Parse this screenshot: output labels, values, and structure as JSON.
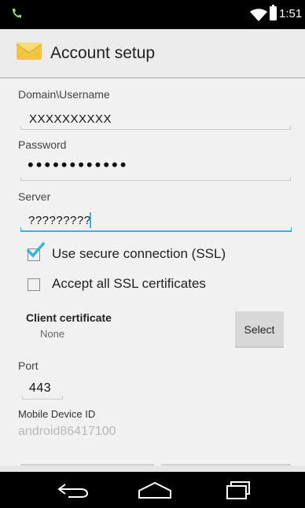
{
  "status_bar": {
    "time": "1:51"
  },
  "action_bar": {
    "title": "Account setup"
  },
  "form": {
    "domain_username": {
      "label": "Domain\\Username",
      "value": "XXXXXXXXXX"
    },
    "password": {
      "label": "Password",
      "masked_value": "••••••••••••"
    },
    "server": {
      "label": "Server",
      "value": "?????????"
    },
    "use_ssl": {
      "label": "Use secure connection (SSL)",
      "checked": true
    },
    "accept_all_ssl": {
      "label": "Accept all SSL certificates",
      "checked": false
    },
    "client_certificate": {
      "label": "Client certificate",
      "value": "None",
      "button_label": "Select"
    },
    "port": {
      "label": "Port",
      "value": "443"
    },
    "mobile_device_id": {
      "label": "Mobile Device ID",
      "value": "android86417100"
    }
  },
  "colors": {
    "accent": "#33b5e5",
    "background": "#f1f1f1",
    "action_bar": "#ececec"
  }
}
